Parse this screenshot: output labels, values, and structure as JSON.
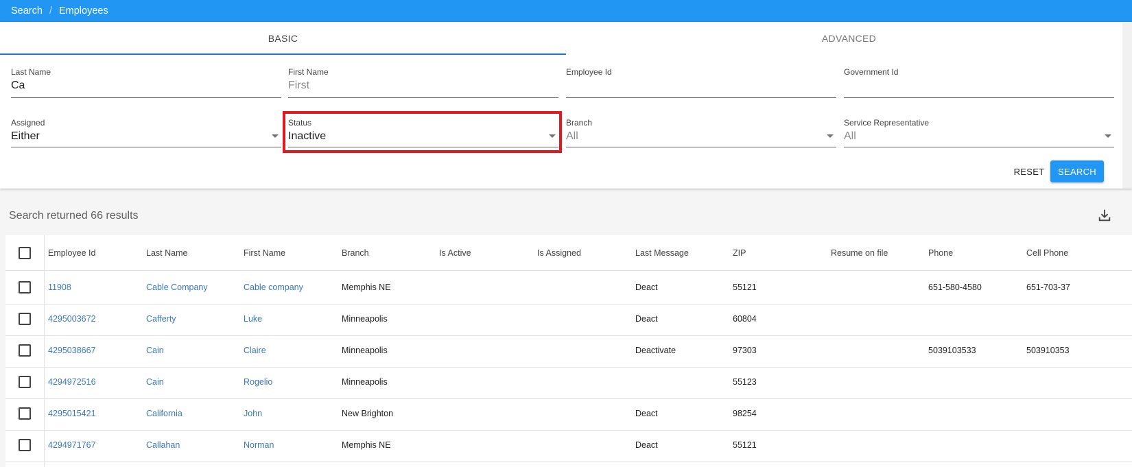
{
  "breadcrumb": {
    "items": [
      "Search",
      "Employees"
    ],
    "separator": "/"
  },
  "tabs": [
    {
      "label": "BASIC"
    },
    {
      "label": "ADVANCED"
    }
  ],
  "form": {
    "last_name": {
      "label": "Last Name",
      "value": "Ca"
    },
    "first_name": {
      "label": "First Name",
      "placeholder": "First"
    },
    "employee_id": {
      "label": "Employee Id",
      "value": ""
    },
    "government_id": {
      "label": "Government Id",
      "value": ""
    },
    "assigned": {
      "label": "Assigned",
      "value": "Either"
    },
    "status": {
      "label": "Status",
      "value": "Inactive"
    },
    "branch": {
      "label": "Branch",
      "value": "All"
    },
    "service_rep": {
      "label": "Service Representative",
      "value": "All"
    }
  },
  "buttons": {
    "reset": "RESET",
    "search": "SEARCH"
  },
  "results": {
    "summary": "Search returned 66 results"
  },
  "table": {
    "columns": [
      "Employee Id",
      "Last Name",
      "First Name",
      "Branch",
      "Is Active",
      "Is Assigned",
      "Last Message",
      "ZIP",
      "Resume on file",
      "Phone",
      "Cell Phone"
    ],
    "rows": [
      [
        "11908",
        "Cable Company",
        "Cable company",
        "Memphis NE",
        "",
        "",
        "Deact",
        "55121",
        "",
        "651-580-4580",
        "651-703-37"
      ],
      [
        "4295003672",
        "Cafferty",
        "Luke",
        "Minneapolis",
        "",
        "",
        "Deact",
        "60804",
        "",
        "",
        ""
      ],
      [
        "4295038667",
        "Cain",
        "Claire",
        "Minneapolis",
        "",
        "",
        "Deactivate",
        "97303",
        "",
        "5039103533",
        "503910353"
      ],
      [
        "4294972516",
        "Cain",
        "Rogelio",
        "Minneapolis",
        "",
        "",
        "",
        "55123",
        "",
        "",
        ""
      ],
      [
        "4295015421",
        "California",
        "John",
        "New Brighton",
        "",
        "",
        "Deact",
        "98254",
        "",
        "",
        ""
      ],
      [
        "4294971767",
        "Callahan",
        "Norman",
        "Memphis NE",
        "",
        "",
        "Deact",
        "55121",
        "",
        "",
        ""
      ]
    ]
  },
  "colors": {
    "primary": "#2196f3",
    "highlight": "#e0191f",
    "link": "#3a78b8"
  },
  "icons": {
    "download": "download-icon",
    "dropdown": "caret-down-icon"
  }
}
